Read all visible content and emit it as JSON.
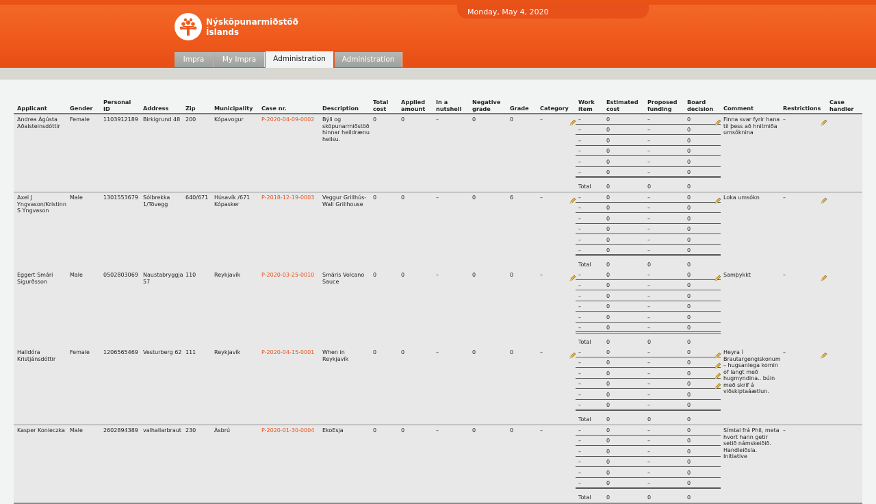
{
  "header": {
    "date": "Monday, May 4, 2020",
    "logo_line1": "Nýsköpunarmiðstöð",
    "logo_line2": "Íslands",
    "tabs": [
      {
        "label": "Impra",
        "active": false
      },
      {
        "label": "My Impra",
        "active": false
      },
      {
        "label": "Administration",
        "active": true
      },
      {
        "label": "Administration",
        "active": false
      }
    ],
    "accent": "#ef5a1c"
  },
  "columns": {
    "applicant": "Applicant",
    "gender": "Gender",
    "personal_id_1": "Personal",
    "personal_id_2": "ID",
    "address": "Address",
    "zip": "Zip",
    "municipality": "Municipality",
    "case_nr": "Case nr.",
    "description": "Description",
    "total_cost_1": "Total",
    "total_cost_2": "cost",
    "applied_1": "Applied",
    "applied_2": "amount",
    "nutshell_1": "In a",
    "nutshell_2": "nutshell",
    "negative_1": "Negative",
    "negative_2": "grade",
    "grade": "Grade",
    "category": "Category",
    "work_1": "Work",
    "work_2": "item",
    "est_1": "Estimated",
    "est_2": "cost",
    "prop_1": "Proposed",
    "prop_2": "funding",
    "board_1": "Board",
    "board_2": "decision",
    "comment": "Comment",
    "restrictions": "Restrictions",
    "handler_1": "Case",
    "handler_2": "handler"
  },
  "rows": [
    {
      "applicant": [
        "Andrea Ágústa",
        "Aðalsteinsdóttir"
      ],
      "gender": "Female",
      "personal_id": "1103912189",
      "address": [
        "Birkigrund 48"
      ],
      "zip": "200",
      "municipality": [
        "Kópavogur"
      ],
      "case_nr": "P-2020-04-09-0002",
      "description": [
        "Býli og",
        "sköpunarmiðstöð",
        "hinnar heildrænu",
        "heilsu."
      ],
      "total_cost": "0",
      "applied": "0",
      "nutshell": "–",
      "negative": "0",
      "grade": "0",
      "category": "–",
      "work_items": [
        {
          "item": "–",
          "est": "0",
          "prop": "–",
          "board": "0"
        },
        {
          "item": "–",
          "est": "0",
          "prop": "–",
          "board": "0"
        },
        {
          "item": "–",
          "est": "0",
          "prop": "–",
          "board": "0"
        },
        {
          "item": "–",
          "est": "0",
          "prop": "–",
          "board": "0"
        },
        {
          "item": "–",
          "est": "0",
          "prop": "–",
          "board": "0"
        },
        {
          "item": "–",
          "est": "0",
          "prop": "–",
          "board": "0"
        }
      ],
      "total": {
        "label": "Total",
        "est": "0",
        "prop": "0",
        "board": "0"
      },
      "comment": [
        "Finna svar fyrir hana",
        "til þess að hnitmiða",
        "umsóknina"
      ],
      "restrictions": "–"
    },
    {
      "applicant": [
        "Axel J",
        "Yngvason/Kristinn",
        "S Yngvason"
      ],
      "gender": "Male",
      "personal_id": "1301553679",
      "address": [
        "Sólbrekka",
        "1/Tövegg"
      ],
      "zip": "640/671",
      "municipality": [
        "Húsavík /671",
        "Kópasker"
      ],
      "case_nr": "P-2018-12-19-0003",
      "description": [
        "Veggur Grillhús-",
        "Wall Grillhouse"
      ],
      "total_cost": "0",
      "applied": "0",
      "nutshell": "–",
      "negative": "0",
      "grade": "6",
      "category": "–",
      "work_items": [
        {
          "item": "–",
          "est": "0",
          "prop": "–",
          "board": "0"
        },
        {
          "item": "–",
          "est": "0",
          "prop": "–",
          "board": "0"
        },
        {
          "item": "–",
          "est": "0",
          "prop": "–",
          "board": "0"
        },
        {
          "item": "–",
          "est": "0",
          "prop": "–",
          "board": "0"
        },
        {
          "item": "–",
          "est": "0",
          "prop": "–",
          "board": "0"
        },
        {
          "item": "–",
          "est": "0",
          "prop": "–",
          "board": "0"
        }
      ],
      "total": {
        "label": "Total",
        "est": "0",
        "prop": "0",
        "board": "0"
      },
      "comment": [
        "Loka umsókn"
      ],
      "restrictions": "–"
    },
    {
      "applicant": [
        "Eggert Smári",
        "Sigurðsson"
      ],
      "gender": "Male",
      "personal_id": "0502803069",
      "address": [
        "Naustabryggja",
        "57"
      ],
      "zip": "110",
      "municipality": [
        "Reykjavík"
      ],
      "case_nr": "P-2020-03-25-0010",
      "description": [
        "Smáris Volcano",
        "Sauce"
      ],
      "total_cost": "0",
      "applied": "0",
      "nutshell": "–",
      "negative": "0",
      "grade": "0",
      "category": "–",
      "work_items": [
        {
          "item": "–",
          "est": "0",
          "prop": "–",
          "board": "0"
        },
        {
          "item": "–",
          "est": "0",
          "prop": "–",
          "board": "0"
        },
        {
          "item": "–",
          "est": "0",
          "prop": "–",
          "board": "0"
        },
        {
          "item": "–",
          "est": "0",
          "prop": "–",
          "board": "0"
        },
        {
          "item": "–",
          "est": "0",
          "prop": "–",
          "board": "0"
        },
        {
          "item": "–",
          "est": "0",
          "prop": "–",
          "board": "0"
        }
      ],
      "total": {
        "label": "Total",
        "est": "0",
        "prop": "0",
        "board": "0"
      },
      "comment": [
        "Samþykkt"
      ],
      "restrictions": "–"
    },
    {
      "applicant": [
        "Halldóra",
        "Kristjánsdóttir"
      ],
      "gender": "Female",
      "personal_id": "1206565469",
      "address": [
        "Vesturberg 62"
      ],
      "zip": "111",
      "municipality": [
        "Reykjavík"
      ],
      "case_nr": "P-2020-04-15-0001",
      "description": [
        "When in",
        "Reykjavík"
      ],
      "total_cost": "0",
      "applied": "0",
      "nutshell": "–",
      "negative": "0",
      "grade": "0",
      "category": "–",
      "work_items": [
        {
          "item": "–",
          "est": "0",
          "prop": "–",
          "board": "0"
        },
        {
          "item": "–",
          "est": "0",
          "prop": "–",
          "board": "0"
        },
        {
          "item": "–",
          "est": "0",
          "prop": "–",
          "board": "0"
        },
        {
          "item": "–",
          "est": "0",
          "prop": "–",
          "board": "0"
        },
        {
          "item": "–",
          "est": "0",
          "prop": "–",
          "board": "0"
        },
        {
          "item": "–",
          "est": "0",
          "prop": "–",
          "board": "0"
        }
      ],
      "total": {
        "label": "Total",
        "est": "0",
        "prop": "0",
        "board": "0"
      },
      "comment": [
        "Heyra í",
        "Brautargengiskonum",
        "– hugsanlega komin",
        "of langt með",
        "hugmyndina.. búin",
        "með skrif á",
        "viðskiptaáætlun."
      ],
      "restrictions": "–"
    },
    {
      "applicant": [
        "Kasper Konieczka"
      ],
      "gender": "Male",
      "personal_id": "2602894389",
      "address": [
        "valhallarbraut"
      ],
      "zip": "230",
      "municipality": [
        "Ásbrú"
      ],
      "case_nr": "P-2020-01-30-0004",
      "description": [
        "EkoEsja"
      ],
      "total_cost": "0",
      "applied": "0",
      "nutshell": "–",
      "negative": "0",
      "grade": "0",
      "category": "–",
      "work_items": [
        {
          "item": "–",
          "est": "0",
          "prop": "–",
          "board": "0"
        },
        {
          "item": "–",
          "est": "0",
          "prop": "–",
          "board": "0"
        },
        {
          "item": "–",
          "est": "0",
          "prop": "–",
          "board": "0"
        },
        {
          "item": "–",
          "est": "0",
          "prop": "–",
          "board": "0"
        },
        {
          "item": "–",
          "est": "0",
          "prop": "–",
          "board": "0"
        },
        {
          "item": "–",
          "est": "0",
          "prop": "–",
          "board": "0"
        }
      ],
      "total": {
        "label": "Total",
        "est": "0",
        "prop": "0",
        "board": "0"
      },
      "comment": [
        "Símtal frá Phil, meta",
        "hvort hann getir",
        "setið námskeiðið.",
        "Handleiðsla.",
        "Initiative"
      ],
      "restrictions": "–"
    }
  ]
}
